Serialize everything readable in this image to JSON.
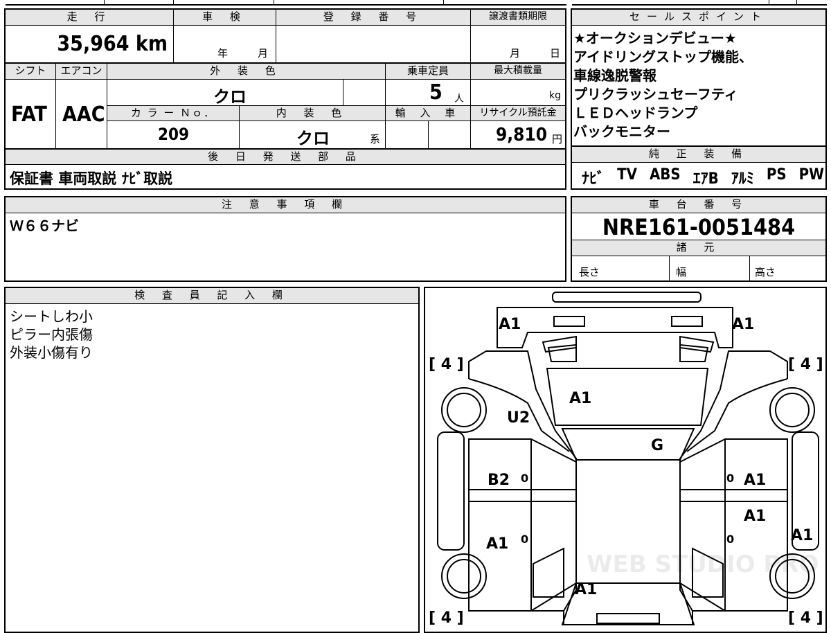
{
  "main": {
    "mileage_label": "走 行",
    "mileage_value": "35,964 km",
    "shaken_label": "車 検",
    "shaken_year": "年",
    "shaken_month": "月",
    "reg_label": "登 録 番 号",
    "deadline_label": "譲渡書類期限",
    "deadline_month": "月",
    "deadline_day": "日",
    "shift_label": "シフト",
    "shift_value": "FAT",
    "ac_label": "エアコン",
    "ac_value": "AAC",
    "ext_color_label": "外 装 色",
    "ext_color_value": "クロ",
    "capacity_label": "乗車定員",
    "capacity_value": "5",
    "capacity_unit": "人",
    "max_load_label": "最大積載量",
    "max_load_unit": "kg",
    "color_no_label": "カ ラ ー Ｎｏ．",
    "color_no_value": "209",
    "int_color_label": "内 装 色",
    "int_color_value": "クロ",
    "int_color_suffix": "系",
    "import_label": "輸 入 車",
    "recycle_label": "リサイクル預託金",
    "recycle_value": "9,810",
    "recycle_unit": "円",
    "later_parts_label": "後 日 発 送 部 品",
    "later_parts_value": "保証書 車両取説 ﾅﾋﾞ取説"
  },
  "sales": {
    "label": "セールスポイント",
    "lines": [
      "★オークションデビュー★",
      "アイドリングストップ機能、",
      "車線逸脱警報",
      "プリクラッシュセーフティ",
      "ＬＥＤヘッドランプ",
      "バックモニター"
    ]
  },
  "equipment": {
    "label": "純 正 装 備",
    "items": [
      "ﾅﾋﾞ",
      "TV",
      "ABS",
      "ｴｱB",
      "ｱﾙﾐ",
      "PS",
      "PW"
    ]
  },
  "notes": {
    "label": "注 意 事 項 欄",
    "text": "Ｗ６６ナビ"
  },
  "chassis": {
    "label": "車 台 番 号",
    "value": "NRE161-0051484",
    "spec_label": "諸 元",
    "length_label": "長さ",
    "width_label": "幅",
    "height_label": "高さ"
  },
  "inspector": {
    "label": "検 査 員 記 入 欄",
    "lines": [
      "シートしわ小",
      "ピラー内張傷",
      "外装小傷有り"
    ]
  },
  "diagram": {
    "tire_marks": [
      "[ 4 ]",
      "[ 4 ]",
      "[ 4 ]",
      "[ 4 ]"
    ],
    "marks": {
      "front_left": "A1",
      "front_right": "A1",
      "hood": "A1",
      "left_fender": "U2",
      "windshield": "G",
      "left_front_door": "B2",
      "right_front_door": "A1",
      "right_rear_door": "A1",
      "left_rear_door": "A1",
      "right_quarter": "A1",
      "rear_gate": "A1"
    },
    "door_zero": "0",
    "watermark": "WEB STUDIO PRO"
  }
}
